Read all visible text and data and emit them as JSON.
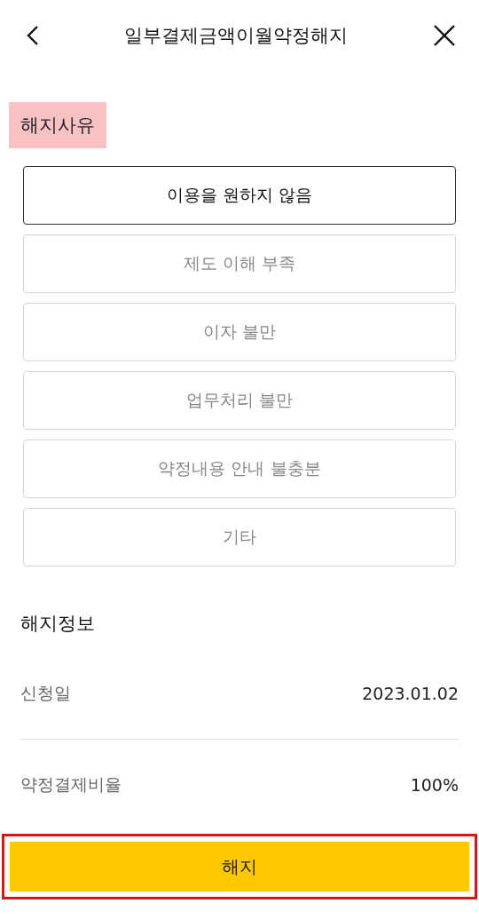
{
  "header": {
    "title": "일부결제금액이월약정해지"
  },
  "reason_section": {
    "title": "해지사유",
    "highlighted": true
  },
  "reasons": [
    {
      "label": "이용을 원하지 않음",
      "selected": true
    },
    {
      "label": "제도 이해 부족",
      "selected": false
    },
    {
      "label": "이자 불만",
      "selected": false
    },
    {
      "label": "업무처리 불만",
      "selected": false
    },
    {
      "label": "약정내용 안내 불충분",
      "selected": false
    },
    {
      "label": "기타",
      "selected": false
    }
  ],
  "info_section": {
    "title": "해지정보"
  },
  "info_rows": [
    {
      "label": "신청일",
      "value": "2023.01.02"
    },
    {
      "label": "약정결제비율",
      "value": "100%"
    }
  ],
  "submit": {
    "label": "해지",
    "outlined": true
  }
}
